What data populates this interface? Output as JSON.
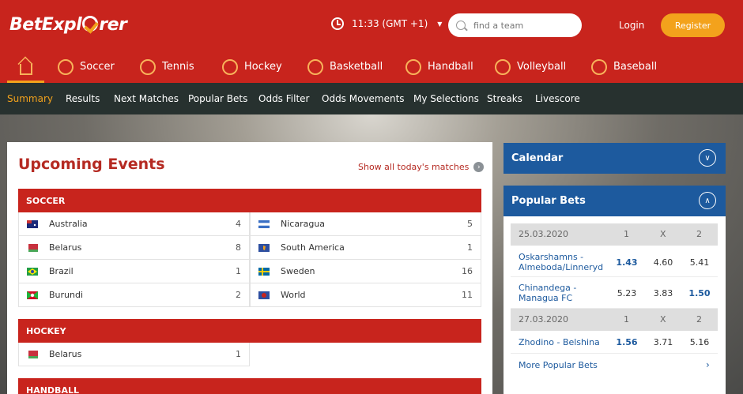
{
  "header": {
    "logo": "BetExplorer",
    "time": "11:33 (GMT +1)",
    "search_placeholder": "find a team",
    "login": "Login",
    "register": "Register"
  },
  "sports": [
    "Soccer",
    "Tennis",
    "Hockey",
    "Basketball",
    "Handball",
    "Volleyball",
    "Baseball"
  ],
  "subnav": [
    "Summary",
    "Results",
    "Next Matches",
    "Popular Bets",
    "Odds Filter",
    "Odds Movements",
    "My Selections",
    "Streaks",
    "Livescore"
  ],
  "main": {
    "title": "Upcoming Events",
    "show_all": "Show all today's matches",
    "sections": [
      {
        "name": "SOCCER",
        "left": [
          {
            "country": "Australia",
            "count": "4"
          },
          {
            "country": "Belarus",
            "count": "8"
          },
          {
            "country": "Brazil",
            "count": "1"
          },
          {
            "country": "Burundi",
            "count": "2"
          }
        ],
        "right": [
          {
            "country": "Nicaragua",
            "count": "5"
          },
          {
            "country": "South America",
            "count": "1"
          },
          {
            "country": "Sweden",
            "count": "16"
          },
          {
            "country": "World",
            "count": "11"
          }
        ]
      },
      {
        "name": "HOCKEY",
        "left": [
          {
            "country": "Belarus",
            "count": "1"
          }
        ],
        "right": []
      },
      {
        "name": "HANDBALL",
        "left": [],
        "right": []
      }
    ]
  },
  "sidebar": {
    "calendar": "Calendar",
    "popular_bets": "Popular Bets",
    "cols": [
      "1",
      "X",
      "2"
    ],
    "groups": [
      {
        "date": "25.03.2020",
        "matches": [
          {
            "team_line1": "Oskarshamns -",
            "team_line2": "Almeboda/Linneryd",
            "o1": "1.43",
            "ox": "4.60",
            "o2": "5.41"
          },
          {
            "team_line1": "Chinandega -",
            "team_line2": "Managua FC",
            "o1": "5.23",
            "ox": "3.83",
            "o2": "1.50"
          }
        ]
      },
      {
        "date": "27.03.2020",
        "matches": [
          {
            "team_line1": "Zhodino - Belshina",
            "team_line2": "",
            "o1": "1.56",
            "ox": "3.71",
            "o2": "5.16"
          }
        ]
      }
    ],
    "more": "More Popular Bets"
  },
  "colors": {
    "brand_red": "#c8241d",
    "accent_orange": "#f3a21c",
    "dark_nav": "#27312f",
    "sidebar_blue": "#1d5a9e"
  }
}
